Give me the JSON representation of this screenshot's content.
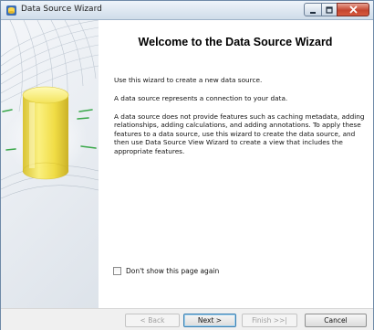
{
  "window": {
    "title": "Data Source Wizard"
  },
  "content": {
    "heading": "Welcome to the Data Source Wizard",
    "paragraphs": [
      "Use this wizard to create a new data source.",
      "A data source represents a connection to your data.",
      "A data source does not provide features such as caching metadata, adding relationships, adding calculations, and adding annotations. To apply these features to a data source, use this wizard to create the data source, and then use Data Source View Wizard to create a view that includes the appropriate features."
    ]
  },
  "checkbox": {
    "label": "Don't show this page again",
    "checked": false
  },
  "buttons": {
    "back": "< Back",
    "next": "Next >",
    "finish": "Finish >>|",
    "cancel": "Cancel"
  },
  "icons": {
    "app": "data-source-icon",
    "minimize": "minimize-icon",
    "maximize": "maximize-icon",
    "close": "close-icon",
    "banner": "database-cylinder-icon"
  },
  "colors": {
    "cylinder": "#f2e04a",
    "close_button": "#c4452f",
    "default_button_border": "#3c7fb1"
  }
}
